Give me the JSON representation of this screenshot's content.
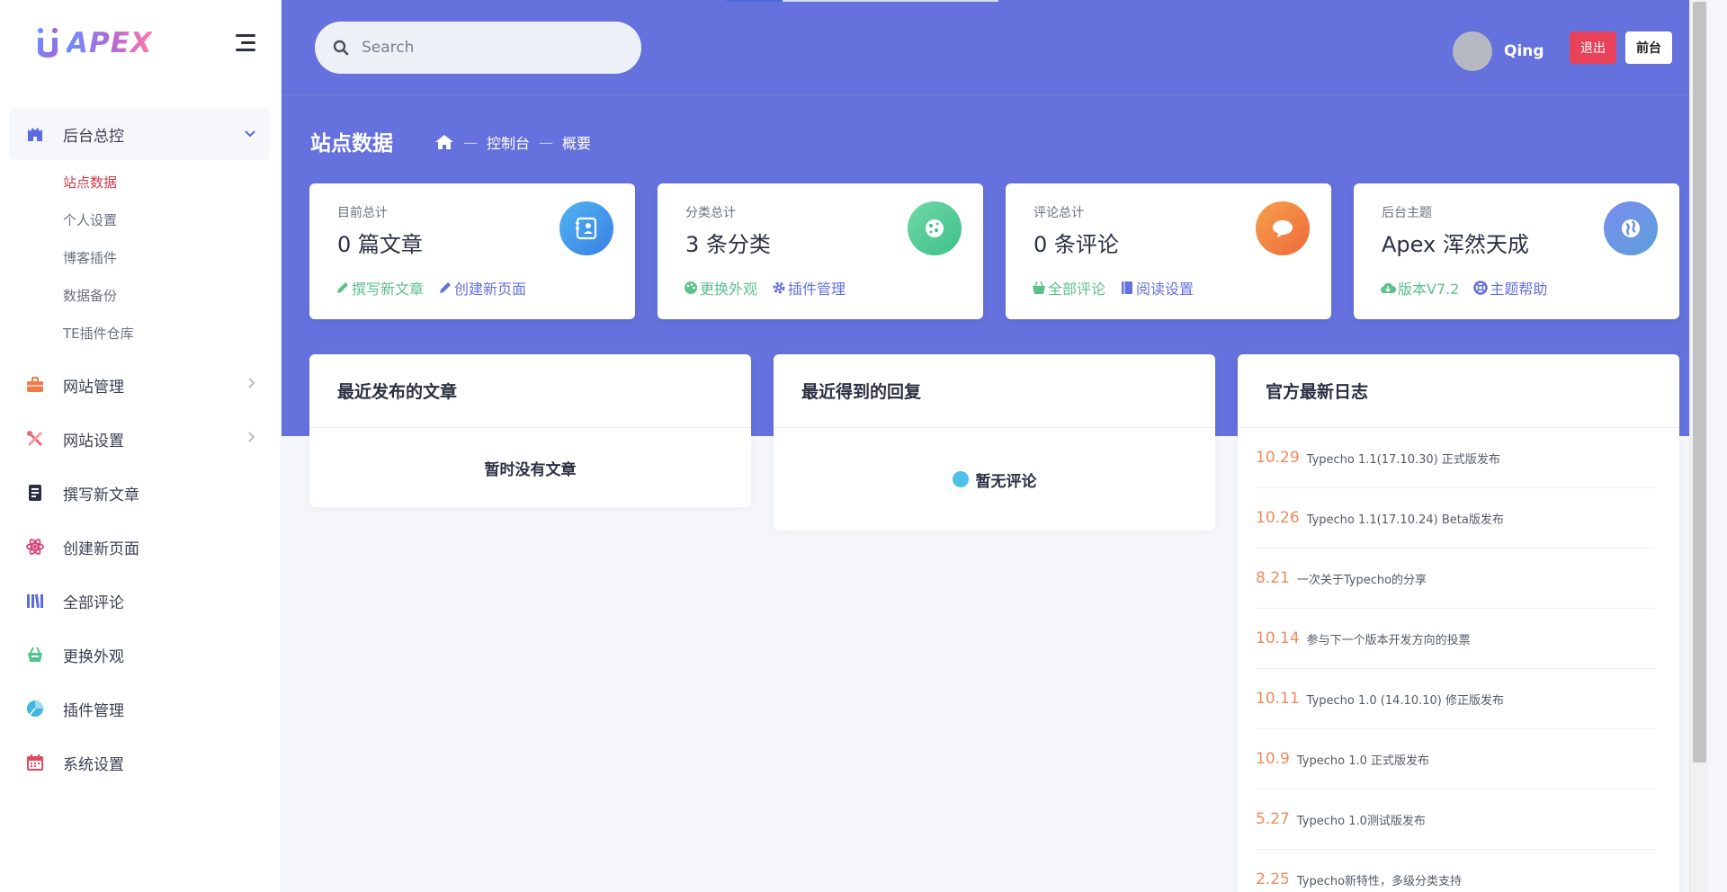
{
  "brand": {
    "logo_text": "APEX"
  },
  "sidebar": {
    "items": [
      {
        "label": "后台总控",
        "icon": "castle-icon",
        "active": true,
        "sub": [
          "站点数据",
          "个人设置",
          "博客插件",
          "数据备份",
          "TE插件仓库"
        ],
        "current_sub": "站点数据"
      },
      {
        "label": "网站管理",
        "icon": "briefcase-icon",
        "has_children": true
      },
      {
        "label": "网站设置",
        "icon": "tools-icon",
        "has_children": true
      },
      {
        "label": "撰写新文章",
        "icon": "document-icon"
      },
      {
        "label": "创建新页面",
        "icon": "atom-icon"
      },
      {
        "label": "全部评论",
        "icon": "books-icon"
      },
      {
        "label": "更换外观",
        "icon": "basket-icon"
      },
      {
        "label": "插件管理",
        "icon": "pie-chart-icon"
      },
      {
        "label": "系统设置",
        "icon": "calendar-icon"
      }
    ]
  },
  "header": {
    "search_placeholder": "Search",
    "username": "Qing",
    "logout_label": "退出",
    "frontend_label": "前台"
  },
  "page": {
    "title": "站点数据",
    "breadcrumb": [
      "控制台",
      "概要"
    ]
  },
  "stats": [
    {
      "label": "目前总计",
      "value": "0 篇文章",
      "icon": "profile-card-icon",
      "gradient": [
        "#4fb3f0",
        "#3a7fe6"
      ],
      "links": [
        {
          "text": "撰写新文章",
          "icon": "pencil-icon",
          "color": "#5cc08a"
        },
        {
          "text": "创建新页面",
          "icon": "pencil-icon",
          "color": "#6571dc"
        }
      ]
    },
    {
      "label": "分类总计",
      "value": "3 条分类",
      "icon": "cookie-icon",
      "gradient": [
        "#6fd8a6",
        "#3fbf8a"
      ],
      "links": [
        {
          "text": "更换外观",
          "icon": "palette-icon",
          "color": "#5cc08a"
        },
        {
          "text": "插件管理",
          "icon": "gear-icon",
          "color": "#6571dc"
        }
      ]
    },
    {
      "label": "评论总计",
      "value": "0 条评论",
      "icon": "chat-bubble-icon",
      "gradient": [
        "#f6a04a",
        "#ef6a3c"
      ],
      "links": [
        {
          "text": "全部评论",
          "icon": "basket-icon",
          "color": "#5cc08a"
        },
        {
          "text": "阅读设置",
          "icon": "book-icon",
          "color": "#6571dc"
        }
      ]
    },
    {
      "label": "后台主题",
      "value": "Apex 浑然天成",
      "icon": "globe-icon",
      "gradient": [
        "#7a8df0",
        "#5c9fd8"
      ],
      "links": [
        {
          "text": "版本V7.2",
          "icon": "cloud-icon",
          "color": "#5cc08a"
        },
        {
          "text": "主题帮助",
          "icon": "lifebuoy-icon",
          "color": "#6571dc"
        }
      ]
    }
  ],
  "panels": {
    "recent_posts": {
      "title": "最近发布的文章",
      "empty": "暂时没有文章"
    },
    "recent_replies": {
      "title": "最近得到的回复",
      "empty": "暂无评论"
    },
    "official_log": {
      "title": "官方最新日志",
      "items": [
        {
          "date": "10.29",
          "text": "Typecho 1.1(17.10.30) 正式版发布"
        },
        {
          "date": "10.26",
          "text": "Typecho 1.1(17.10.24) Beta版发布"
        },
        {
          "date": "8.21",
          "text": "一次关于Typecho的分享"
        },
        {
          "date": "10.14",
          "text": "参与下一个版本开发方向的投票"
        },
        {
          "date": "10.11",
          "text": "Typecho 1.0 (14.10.10) 修正版发布"
        },
        {
          "date": "10.9",
          "text": "Typecho 1.0 正式版发布"
        },
        {
          "date": "5.27",
          "text": "Typecho 1.0测试版发布"
        },
        {
          "date": "2.25",
          "text": "Typecho新特性，多级分类支持"
        }
      ]
    }
  },
  "colors": {
    "hero": "#6571dc",
    "accent_red": "#e8415a",
    "log_date": "#ef8a5c",
    "current_sub": "#d43c4c"
  }
}
